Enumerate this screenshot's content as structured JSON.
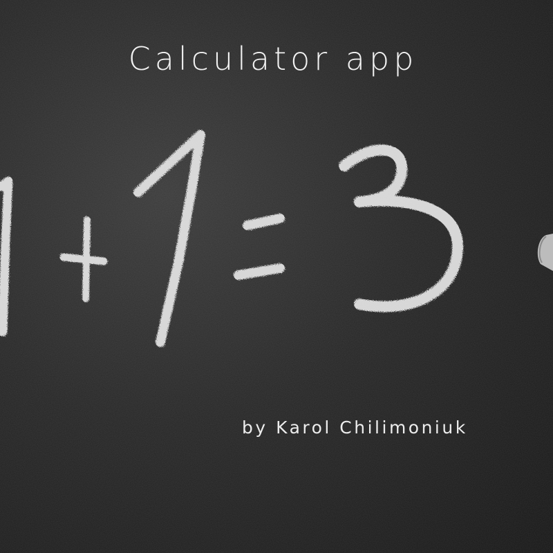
{
  "image": {
    "title": "Calculator app",
    "byline": "by Karol Chilimoniuk",
    "chalkboard_equation": "1+1=3",
    "colors": {
      "board": "#262626",
      "chalk": "#e8e8e8",
      "text": "#f2f2f2"
    }
  }
}
